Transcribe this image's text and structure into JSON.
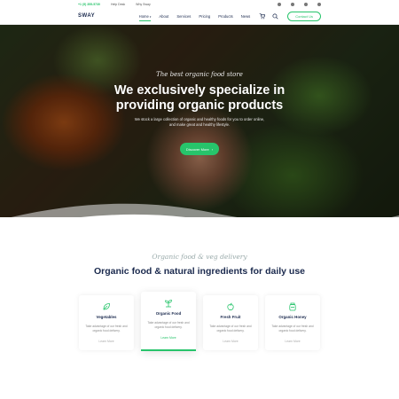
{
  "topbar": {
    "phone": "+1 (5) 355-5730",
    "links": [
      "Help Desk",
      "Why Sway"
    ],
    "socials": [
      "facebook-icon",
      "twitter-icon",
      "instagram-icon",
      "youtube-icon"
    ]
  },
  "header": {
    "logo": "SWAY",
    "nav": [
      "Home",
      "About",
      "Services",
      "Pricing",
      "Products",
      "News"
    ],
    "nav_caret": "▾",
    "contact_label": "Contact Us"
  },
  "hero": {
    "script": "The best organic food store",
    "title_line1": "We exclusively specialize in",
    "title_line2": "providing organic products",
    "subtitle": "We stock a large collection of organic and healthy foods for you to order online, and make great and healthy lifestyle.",
    "button_label": "Discover More",
    "button_arrow": "›"
  },
  "section": {
    "script": "Organic food & veg delivery",
    "title": "Organic food & natural ingredients for daily use"
  },
  "cards": [
    {
      "title": "Vegetables",
      "desc": "Take advantage of our fresh and organic food delivery.",
      "link": "Learn More",
      "icon": "leaf-icon"
    },
    {
      "title": "Organic Food",
      "desc": "Take advantage of our fresh and organic food delivery.",
      "link": "Learn More",
      "icon": "sprout-icon"
    },
    {
      "title": "Fresh Fruit",
      "desc": "Take advantage of our fresh and organic food delivery.",
      "link": "Learn More",
      "icon": "apple-icon"
    },
    {
      "title": "Organic Honey",
      "desc": "Take advantage of our fresh and organic food delivery.",
      "link": "Learn More",
      "icon": "honey-jar-icon"
    }
  ],
  "colors": {
    "accent": "#27c46b",
    "heading": "#1b2a4e"
  }
}
